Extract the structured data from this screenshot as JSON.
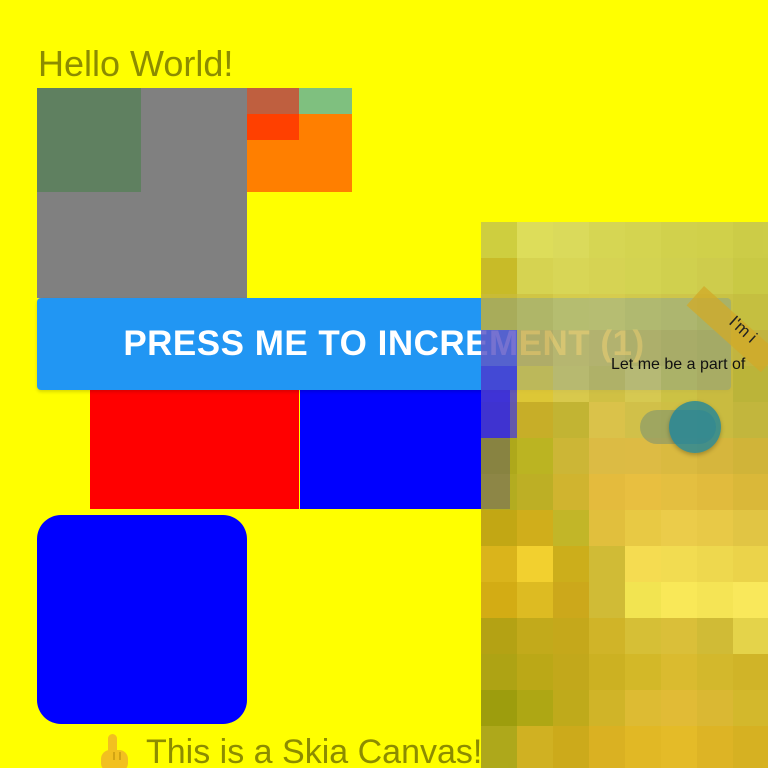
{
  "header": {
    "title": "Hello World!"
  },
  "button": {
    "label": "PRESS ME TO INCREMENT (1)"
  },
  "overlay": {
    "ribbon_text": "I'm i",
    "caption": "Let me be a part of"
  },
  "canvas": {
    "caption": "This is a Skia Canvas!",
    "hand_icon": "pointing-up-hand-icon"
  },
  "colors": {
    "background": "#ffff00",
    "button": "#2196f3",
    "red": "#ff0000",
    "blue": "#0000ff",
    "gray": "#808080",
    "orange": "#ff7f00"
  },
  "switch": {
    "on": true
  }
}
